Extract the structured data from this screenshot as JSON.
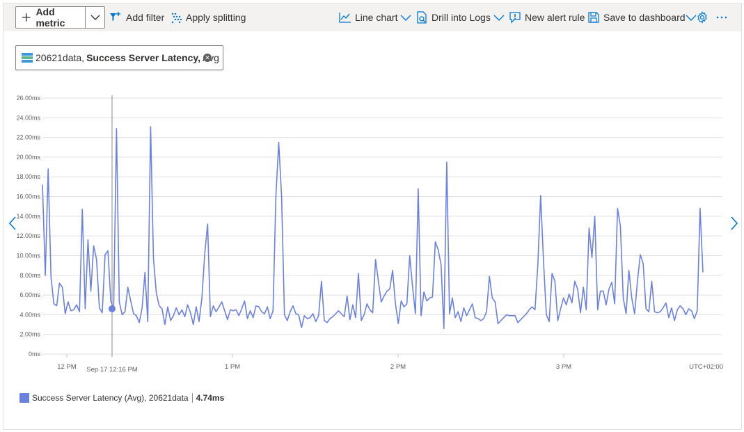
{
  "toolbar": {
    "add_metric": "Add metric",
    "add_filter": "Add filter",
    "apply_splitting": "Apply splitting",
    "line_chart": "Line chart",
    "drill_into_logs": "Drill into Logs",
    "new_alert_rule": "New alert rule",
    "save_to_dashboard": "Save to dashboard"
  },
  "metric_pill": {
    "resource": "20621data,",
    "metric": "Success Server Latency,",
    "aggregation": "Avg"
  },
  "accent_color": "#6b81e0",
  "chart_data": {
    "type": "line",
    "y_tick_labels": [
      "0ms",
      "2.00ms",
      "4.00ms",
      "6.00ms",
      "8.00ms",
      "10.00ms",
      "12.00ms",
      "14.00ms",
      "16.00ms",
      "18.00ms",
      "20.00ms",
      "22.00ms",
      "24.00ms",
      "26.00ms"
    ],
    "ylim": [
      0,
      26
    ],
    "x_tick_labels": [
      "12 PM",
      "1 PM",
      "2 PM",
      "3 PM"
    ],
    "timezone_label": "UTC+02:00",
    "cursor_label": "Sep 17 12:16 PM",
    "cursor_value": 4.6,
    "series": [
      {
        "name": "Success Server Latency (Avg), 20621data",
        "color": "#6b81e0",
        "values": [
          17.2,
          8,
          18.8,
          7.8,
          5.1,
          4.9,
          7.2,
          6.8,
          4.1,
          5.3,
          4.4,
          4.5,
          5.0,
          4.3,
          14.7,
          4.6,
          11.6,
          6.4,
          11,
          9.6,
          4.7,
          4.2,
          10.1,
          10.5,
          5.4,
          4.6,
          22.9,
          5.3,
          4.0,
          4.3,
          6.8,
          5.4,
          4.1,
          3.9,
          3.2,
          4.7,
          8.3,
          3.3,
          23.1,
          9.7,
          6.2,
          4.9,
          4.6,
          3.0,
          4.8,
          3.4,
          3.9,
          4.7,
          4.0,
          4.5,
          3.8,
          5.0,
          4.2,
          3.0,
          4.8,
          3.3,
          5.7,
          10.2,
          13.2,
          3.8,
          4.9,
          4.3,
          4.8,
          5.3,
          4.4,
          3.5,
          4.5,
          4.4,
          4.5,
          3.9,
          4.6,
          5.4,
          3.6,
          4.4,
          3.7,
          4.9,
          4.8,
          4.3,
          4.1,
          4.8,
          3.6,
          4.4,
          16,
          21.5,
          16,
          4.0,
          3.4,
          4.3,
          4.9,
          4.1,
          4.0,
          2.7,
          3.9,
          3.6,
          3.7,
          4.1,
          3.3,
          3.9,
          7.4,
          3.4,
          3.2,
          3.6,
          3.8,
          4.1,
          4.4,
          4.1,
          3.8,
          5.9,
          3.5,
          5.0,
          3.7,
          8.2,
          3.4,
          4.0,
          5.1,
          4.5,
          4.2,
          9.6,
          7.4,
          5.3,
          5.9,
          6.4,
          6.6,
          8.5,
          5.1,
          3.1,
          5.4,
          4.8,
          5.1,
          10.0,
          6.8,
          4.1,
          16.8,
          3.9,
          6.3,
          5.4,
          5.7,
          5.8,
          11.4,
          10.6,
          9.1,
          2.6,
          19.5,
          4.1,
          5.7,
          3.7,
          4.3,
          3.3,
          4.7,
          3.9,
          4.5,
          5.1,
          3.7,
          3.6,
          3.4,
          3.6,
          4.3,
          7.9,
          5.7,
          5.3,
          3.1,
          3.4,
          3.7,
          4.0,
          3.9,
          3.9,
          3.9,
          3.2,
          3.5,
          3.8,
          4.1,
          4.5,
          4.8,
          4.5,
          9.1,
          16.1,
          9.5,
          4.0,
          3.3,
          8.2,
          7.4,
          3.4,
          4.6,
          5.7,
          5.0,
          6.1,
          5.2,
          7.4,
          6.6,
          4.2,
          6.8,
          4.5,
          12.8,
          9.8,
          14,
          4.5,
          6.4,
          6.4,
          5.0,
          6.6,
          7.3,
          5.1,
          14.8,
          13,
          5.7,
          4.1,
          8.5,
          5.7,
          4.1,
          7.4,
          10.1,
          9.2,
          4.6,
          4.3,
          7.4,
          4.3,
          4.2,
          4.3,
          4.7,
          5.2,
          3.7,
          4.7,
          3.4,
          4.5,
          4.9,
          4.6,
          4.0,
          4.6,
          4.4,
          3.6,
          4.4,
          14.8,
          8.3
        ]
      }
    ]
  },
  "legend": {
    "label": "Success Server Latency (Avg), 20621data",
    "value": "4.74ms"
  }
}
